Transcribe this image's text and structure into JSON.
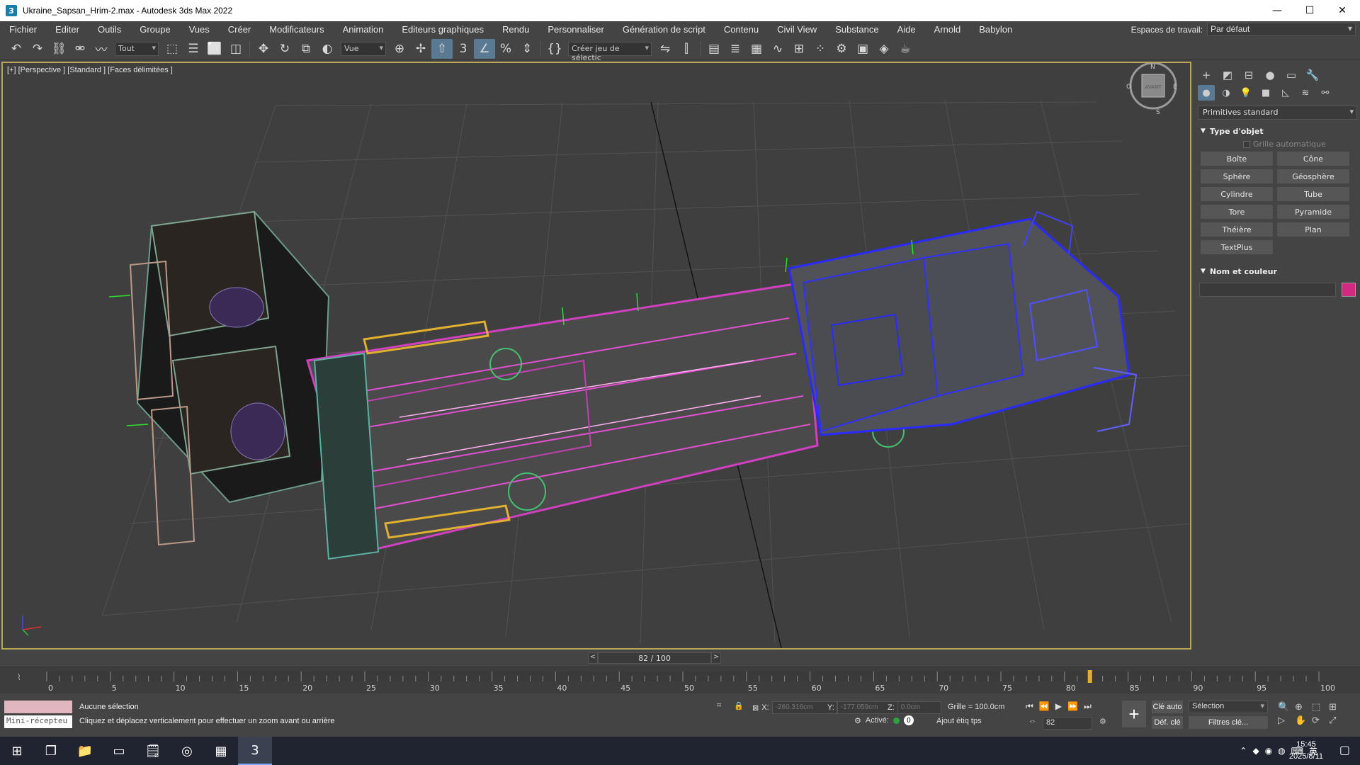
{
  "window": {
    "title": "Ukraine_Sapsan_Hrim-2.max - Autodesk 3ds Max 2022",
    "app_icon": "3",
    "min": "—",
    "max": "☐",
    "close": "✕"
  },
  "menu": {
    "items": [
      "Fichier",
      "Editer",
      "Outils",
      "Groupe",
      "Vues",
      "Créer",
      "Modificateurs",
      "Animation",
      "Editeurs graphiques",
      "Rendu",
      "Personnaliser",
      "Génération de script",
      "Contenu",
      "Civil View",
      "Substance",
      "Aide",
      "Arnold",
      "Babylon"
    ],
    "workspace_label": "Espaces de travail:",
    "workspace_value": "Par défaut"
  },
  "toolbar": {
    "filter_value": "Tout",
    "refcoord_value": "Vue",
    "selset_value": "Créer jeu de sélectic"
  },
  "viewport": {
    "label": "[+] [Perspective ] [Standard ] [Faces délimitées ]",
    "viewcube_label": "AVANT",
    "compass": [
      "N",
      "E",
      "S",
      "O"
    ]
  },
  "command_panel": {
    "category_value": "Primitives standard",
    "rollout_type": "Type d'objet",
    "autogrid_label": "Grille automatique",
    "primitives": [
      "Boîte",
      "Cône",
      "Sphère",
      "Géosphère",
      "Cylindre",
      "Tube",
      "Tore",
      "Pyramide",
      "Théière",
      "Plan",
      "TextPlus"
    ],
    "rollout_name": "Nom et couleur",
    "object_color": "#d12a80"
  },
  "time": {
    "slider_text": "82 / 100",
    "prev": "<",
    "next": ">",
    "current_frame": 82,
    "total_frames": 100,
    "ticks": [
      "0",
      "5",
      "10",
      "15",
      "20",
      "25",
      "30",
      "35",
      "40",
      "45",
      "50",
      "55",
      "60",
      "65",
      "70",
      "75",
      "80",
      "85",
      "90",
      "95",
      "100"
    ]
  },
  "status": {
    "mini_listener": "Mini-récepteu",
    "selection": "Aucune sélection",
    "hint": "Cliquez et déplacez verticalement pour effectuer un zoom avant ou arrière",
    "x_label": "X:",
    "x_value": "-260.316cm",
    "y_label": "Y:",
    "y_value": "-177.059cm",
    "z_label": "Z:",
    "z_value": "0.0cm",
    "grid": "Grille = 100.0cm",
    "active_label": "Activé:",
    "active_count": "0",
    "add_tag": "Ajout étiq tps",
    "frame_value": "82",
    "auto_key": "Clé auto",
    "set_key": "Déf. clé",
    "selection_dd": "Sélection",
    "key_filters": "Filtres clé..."
  },
  "taskbar": {
    "time": "15:45",
    "date": "2025/8/11",
    "ime": "英"
  }
}
